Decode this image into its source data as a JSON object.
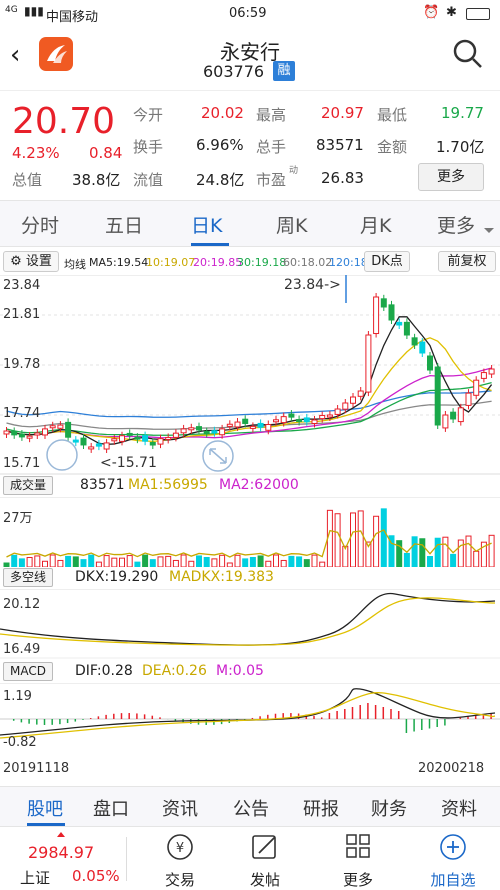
{
  "status": {
    "carrier": "中国移动",
    "net": "4G",
    "time": "06:59",
    "battery": "battery"
  },
  "header": {
    "name": "永安行",
    "code": "603776",
    "tag": "融",
    "back_icon": "back-arrow-icon",
    "logo_icon": "app-logo-icon",
    "search_icon": "search-icon"
  },
  "quote": {
    "price": "20.70",
    "pct": "4.23%",
    "chg": "0.84",
    "total_label": "总值",
    "total": "38.8亿",
    "cells": [
      [
        "今开",
        "20.02",
        "最高",
        "20.97",
        "最低",
        "19.77"
      ],
      [
        "换手",
        "6.96%",
        "总手",
        "83571",
        "金额",
        "1.70亿"
      ],
      [
        "流值",
        "24.8亿",
        "市盈",
        "26.83"
      ]
    ],
    "pe_sup": "动",
    "more": "更多"
  },
  "tabs": [
    "分时",
    "五日",
    "日K",
    "周K",
    "月K",
    "更多"
  ],
  "chart_bar": {
    "settings": "设置",
    "ma_label": "均线",
    "ma5": "MA5:19.54",
    "ma10": "10:19.07",
    "ma20": "20:19.85",
    "ma30": "30:19.18",
    "ma60": "60:18.02",
    "ma120": "120:18.",
    "dk": "DK点",
    "fq": "前复权"
  },
  "kline": {
    "y_top": "23.84",
    "y_mid1": "21.81",
    "y_mid2": "19.78",
    "y_mid3": "17.74",
    "y_bot": "15.71",
    "hi_ann": "23.84->",
    "lo_ann": "<-15.71"
  },
  "vol": {
    "label": "成交量",
    "v": "83571",
    "ma1": "MA1:56995",
    "ma2": "MA2:62000",
    "y_top": "27万"
  },
  "dk": {
    "label": "多空线",
    "dkx": "DKX:19.290",
    "madkx": "MADKX:19.383",
    "y_top": "20.12",
    "y_bot": "16.49"
  },
  "macd": {
    "label": "MACD",
    "dif": "DIF:0.28",
    "dea": "DEA:0.26",
    "m": "M:0.05",
    "y_top": "1.19",
    "y_bot": "-0.82"
  },
  "dates": {
    "start": "20191118",
    "end": "20200218"
  },
  "bottom_tabs": [
    "股吧",
    "盘口",
    "资讯",
    "公告",
    "研报",
    "财务",
    "资料"
  ],
  "footer": {
    "index_name": "上证",
    "index_val": "2984.97",
    "index_pct": "0.05%",
    "items": [
      "交易",
      "发帖",
      "更多",
      "加自选"
    ]
  },
  "colors": {
    "up": "#e8202a",
    "down": "#1aa84a",
    "accent": "#1b68c8",
    "cyan": "#00d0e0"
  }
}
